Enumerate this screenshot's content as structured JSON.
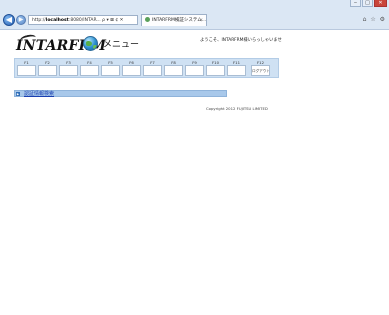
{
  "browser": {
    "address": "http://",
    "address_host": "localhost",
    "address_rest": ":8080/INTAR... ρ ▾ ⊠ ¢ ✕",
    "tab_title": "INTARFRM検証システム...",
    "tab_close": "×",
    "back_label": "◀",
    "forward_label": "▶",
    "toolbar_icons": "⌂ ☆ ⚙",
    "window_controls": [
      "‒",
      "□",
      "✕"
    ]
  },
  "header": {
    "logo_text": "INTARFRM",
    "menu_title": "メニュー",
    "welcome_text": "ようこそ、INTARFRM様いらっしゃいませ"
  },
  "fkeys": [
    {
      "label": "F1",
      "button": ""
    },
    {
      "label": "F2",
      "button": ""
    },
    {
      "label": "F3",
      "button": ""
    },
    {
      "label": "F4",
      "button": ""
    },
    {
      "label": "F5",
      "button": ""
    },
    {
      "label": "F6",
      "button": ""
    },
    {
      "label": "F7",
      "button": ""
    },
    {
      "label": "F8",
      "button": ""
    },
    {
      "label": "F9",
      "button": ""
    },
    {
      "label": "F10",
      "button": ""
    },
    {
      "label": "F11",
      "button": ""
    },
    {
      "label": "F12",
      "button": "ログアウト"
    }
  ],
  "section": {
    "link_text": "認証情報検索",
    "arrow": "▶"
  },
  "footer": {
    "copyright": "Copyright 2012 FUJITSU LIMITED"
  }
}
